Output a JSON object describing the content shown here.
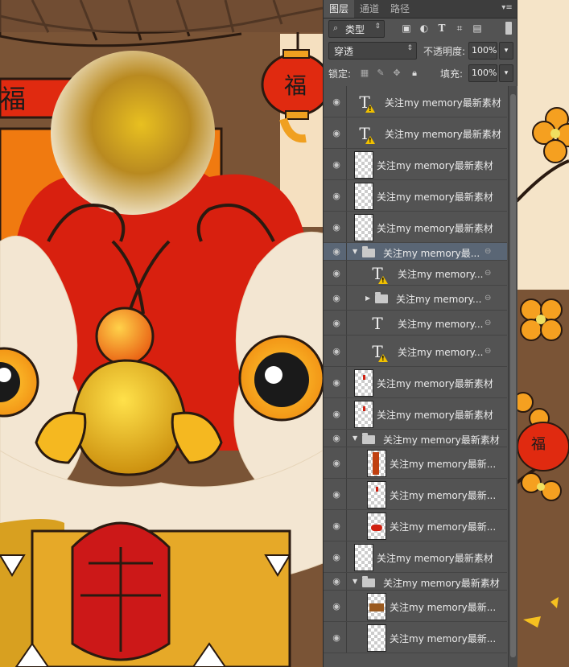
{
  "panel_tabs": [
    {
      "label": "图层",
      "active": true
    },
    {
      "label": "通道",
      "active": false
    },
    {
      "label": "路径",
      "active": false
    }
  ],
  "panel_menu_icon": "panel-menu-icon",
  "filter": {
    "kind_label": "类型",
    "search_icon": "search-icon",
    "tool_icons": [
      "image-filter-icon",
      "adjustment-filter-icon",
      "type-filter-icon",
      "shape-filter-icon",
      "smart-object-filter-icon"
    ]
  },
  "blend_mode": "穿透",
  "opacity": {
    "label": "不透明度:",
    "value": "100%"
  },
  "lock": {
    "label": "锁定:",
    "icons": [
      "lock-transparent-icon",
      "lock-brush-icon",
      "lock-move-icon",
      "lock-all-icon"
    ]
  },
  "fill": {
    "label": "填充:",
    "value": "100%"
  },
  "layers": [
    {
      "name": "关注my memory最新素材",
      "kind": "text",
      "warning": true,
      "indent": 0
    },
    {
      "name": "关注my memory最新素材",
      "kind": "text",
      "warning": true,
      "indent": 0
    },
    {
      "name": "关注my memory最新素材",
      "kind": "pixel",
      "indent": 0
    },
    {
      "name": "关注my memory最新素材",
      "kind": "pixel",
      "indent": 0
    },
    {
      "name": "关注my memory最新素材",
      "kind": "pixel",
      "indent": 0
    },
    {
      "name": "关注my memory最...",
      "kind": "group",
      "expanded": true,
      "linked": true,
      "selected": true,
      "indent": 0
    },
    {
      "name": "关注my memory...",
      "kind": "text",
      "warning": true,
      "linked": true,
      "indent": 1
    },
    {
      "name": "关注my memory...",
      "kind": "group",
      "expanded": false,
      "linked": true,
      "indent": 1
    },
    {
      "name": "关注my memory...",
      "kind": "text",
      "warning": false,
      "linked": true,
      "indent": 1
    },
    {
      "name": "关注my memory...",
      "kind": "text",
      "warning": true,
      "linked": true,
      "indent": 1
    },
    {
      "name": "关注my memory最新素材",
      "kind": "pixel",
      "thumb_mark": "red",
      "indent": 0
    },
    {
      "name": "关注my memory最新素材",
      "kind": "pixel",
      "thumb_mark": "red",
      "indent": 0
    },
    {
      "name": "关注my memory最新素材",
      "kind": "group",
      "expanded": true,
      "indent": 0
    },
    {
      "name": "关注my memory最新...",
      "kind": "pixel",
      "thumb_mark": "figure",
      "indent": 1
    },
    {
      "name": "关注my memory最新...",
      "kind": "pixel",
      "thumb_mark": "red",
      "indent": 1
    },
    {
      "name": "关注my memory最新...",
      "kind": "pixel",
      "thumb_mark": "red-big",
      "indent": 1
    },
    {
      "name": "关注my memory最新素材",
      "kind": "pixel",
      "indent": 0
    },
    {
      "name": "关注my memory最新素材",
      "kind": "group",
      "expanded": true,
      "indent": 0
    },
    {
      "name": "关注my memory最新...",
      "kind": "pixel",
      "thumb_mark": "brown",
      "indent": 1
    },
    {
      "name": "关注my memory最新...",
      "kind": "pixel",
      "indent": 1
    }
  ],
  "artwork": {
    "left_banner_text": "福",
    "lantern_text": "福",
    "lantern_right_text": "福"
  }
}
